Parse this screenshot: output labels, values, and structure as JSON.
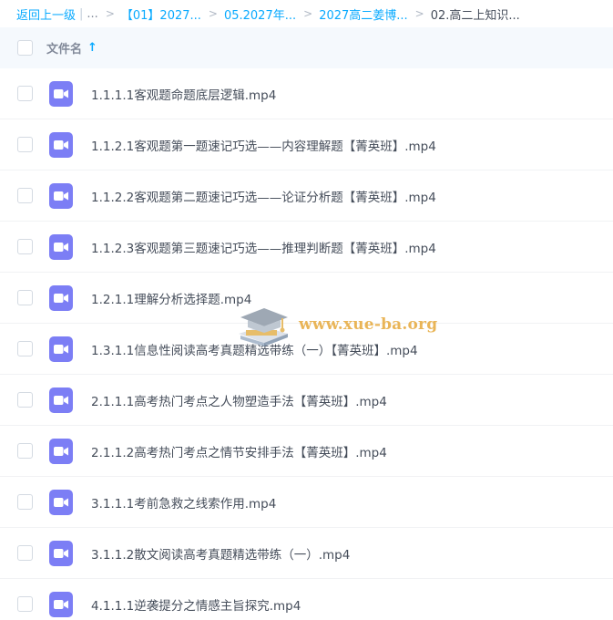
{
  "breadcrumb": {
    "back": "返回上一级",
    "separator": "|",
    "ellipsis": "...",
    "chevron": ">",
    "crumbs": [
      "【01】2027...",
      "05.2027年...",
      "2027高二姜博...",
      "02.高二上知识..."
    ]
  },
  "header": {
    "column_label": "文件名",
    "sort_icon": "arrow-up-icon",
    "sort_glyph": "↑"
  },
  "files": [
    {
      "name": "1.1.1.1客观题命题底层逻辑.mp4",
      "icon": "video-file-icon"
    },
    {
      "name": "1.1.2.1客观题第一题速记巧选——内容理解题【菁英班】.mp4",
      "icon": "video-file-icon"
    },
    {
      "name": "1.1.2.2客观题第二题速记巧选——论证分析题【菁英班】.mp4",
      "icon": "video-file-icon"
    },
    {
      "name": "1.1.2.3客观题第三题速记巧选——推理判断题【菁英班】.mp4",
      "icon": "video-file-icon"
    },
    {
      "name": "1.2.1.1理解分析选择题.mp4",
      "icon": "video-file-icon"
    },
    {
      "name": "1.3.1.1信息性阅读高考真题精选带练（一）【菁英班】.mp4",
      "icon": "video-file-icon"
    },
    {
      "name": "2.1.1.1高考热门考点之人物塑造手法【菁英班】.mp4",
      "icon": "video-file-icon"
    },
    {
      "name": "2.1.1.2高考热门考点之情节安排手法【菁英班】.mp4",
      "icon": "video-file-icon"
    },
    {
      "name": "3.1.1.1考前急救之线索作用.mp4",
      "icon": "video-file-icon"
    },
    {
      "name": "3.1.1.2散文阅读高考真题精选带练（一）.mp4",
      "icon": "video-file-icon"
    },
    {
      "name": "4.1.1.1逆袭提分之情感主旨探究.mp4",
      "icon": "video-file-icon"
    }
  ],
  "watermark": {
    "text": "www.xue-ba.org",
    "icon": "graduation-cap-book-icon"
  },
  "colors": {
    "accent": "#09aaff",
    "video_icon": "#7c7ef5",
    "header_bg": "#f5f9fd",
    "watermark": "#e6a93c"
  }
}
